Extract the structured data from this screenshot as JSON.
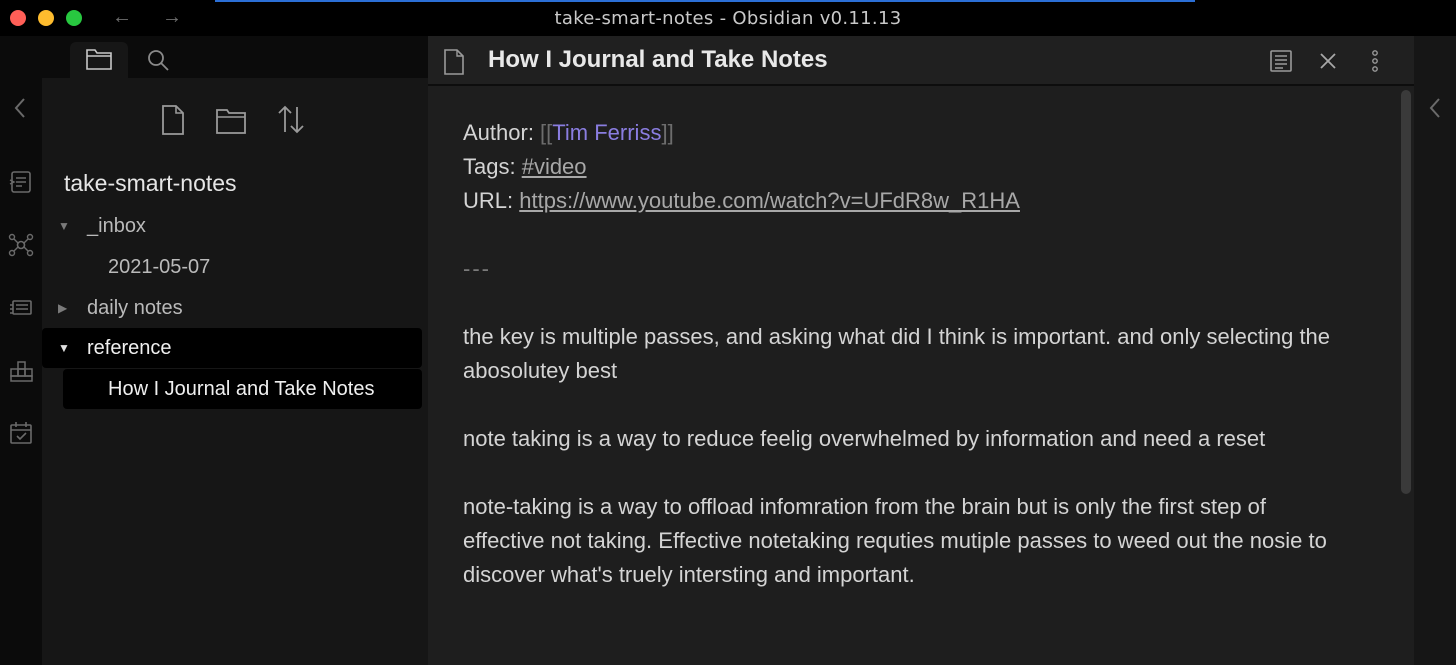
{
  "window": {
    "title": "take-smart-notes - Obsidian v0.11.13"
  },
  "ribbon": {
    "items": [
      "collapse-left-icon",
      "command-palette-icon",
      "graph-view-icon",
      "slides-icon",
      "kanban-icon",
      "calendar-icon"
    ]
  },
  "sidebar": {
    "vault_name": "take-smart-notes",
    "tree": {
      "inbox": "_inbox",
      "inbox_date": "2021-05-07",
      "daily": "daily notes",
      "reference": "reference",
      "note": "How I Journal and Take Notes"
    }
  },
  "editor": {
    "title": "How I Journal and Take Notes",
    "author_label": "Author: ",
    "author_link_open": "[[",
    "author_link": "Tim Ferriss",
    "author_link_close": "]]",
    "tags_label": "Tags: ",
    "tag": "#video",
    "url_label": "URL: ",
    "url": "https://www.youtube.com/watch?v=UFdR8w_R1HA",
    "hr": "---",
    "paragraphs": [
      "the key is multiple passes, and asking what did I think is important. and only selecting the abosolutey best",
      "note taking is a way to reduce feelig overwhelmed by information and need a reset",
      "note-taking is a way to offload infomration from the brain but is only the first step of effective not taking. Effective notetaking requties mutiple passes to weed out the nosie to discover what's truely intersting and important."
    ]
  },
  "colors": {
    "accent_link": "#8a7de0",
    "background_editor": "#1e1e1e",
    "background_sidebar": "#161616"
  }
}
